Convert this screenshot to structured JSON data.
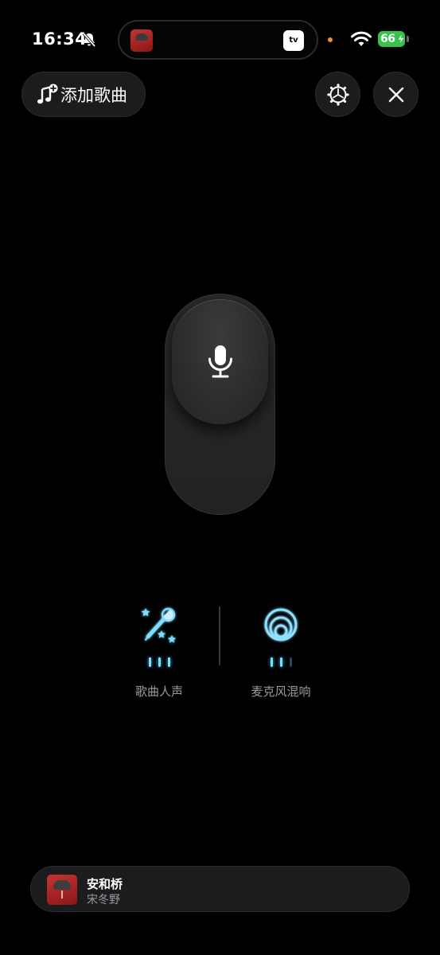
{
  "status_bar": {
    "time": "16:34",
    "battery": "66",
    "island_app": "tv"
  },
  "toolbar": {
    "add_song_label": "添加歌曲"
  },
  "modes": [
    {
      "label": "歌曲人声",
      "icon": "karaoke-mic-stars-icon",
      "level": 3,
      "max_level": 3
    },
    {
      "label": "麦克风混响",
      "icon": "concentric-rings-icon",
      "level": 2,
      "max_level": 3
    }
  ],
  "now_playing": {
    "title": "安和桥",
    "artist": "宋冬野"
  },
  "colors": {
    "accent_glow": "#7fdcff",
    "background": "#000000",
    "surface": "#1c1c1e",
    "battery": "#37c24e"
  }
}
